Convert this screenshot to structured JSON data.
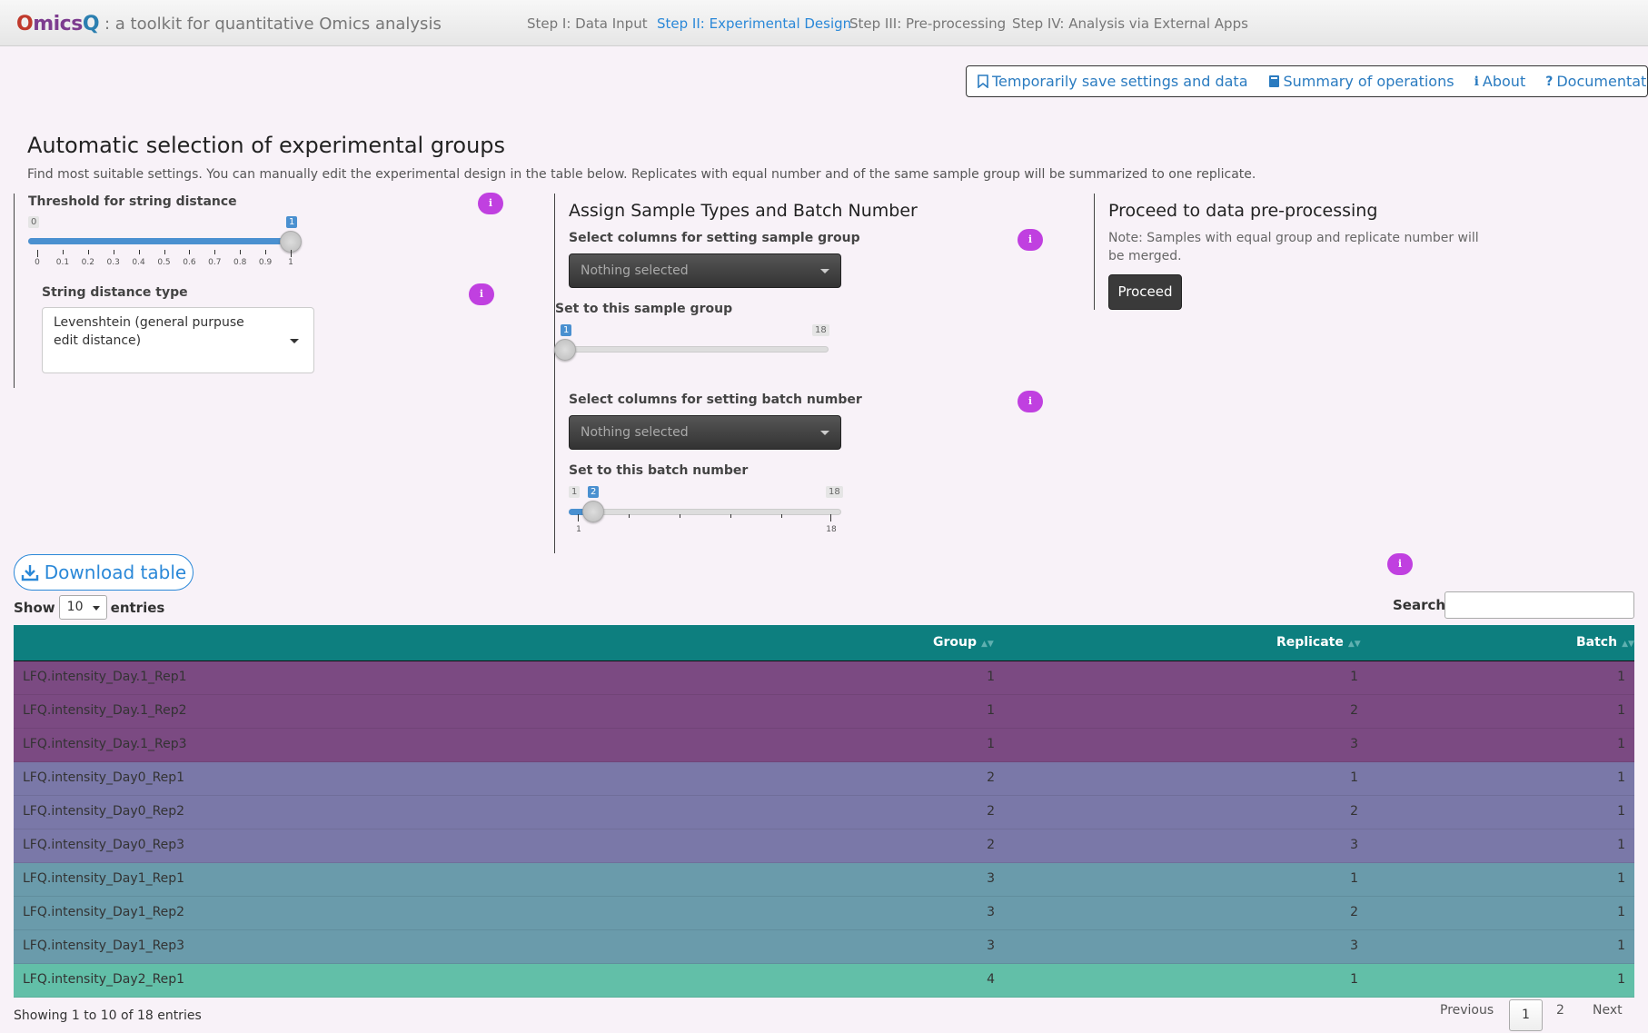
{
  "brand": {
    "logo": "OmicsQ",
    "subtitle": ": a toolkit for quantitative Omics analysis"
  },
  "nav": [
    {
      "label": "Step I: Data Input",
      "active": false
    },
    {
      "label": "Step II: Experimental Design",
      "active": true
    },
    {
      "label": "Step III: Pre-processing",
      "active": false
    },
    {
      "label": "Step IV: Analysis via External Apps",
      "active": false
    }
  ],
  "top_buttons": [
    {
      "label": "Temporarily save settings and data",
      "icon": "bookmark-icon"
    },
    {
      "label": "Summary of operations",
      "icon": "book-icon"
    },
    {
      "label": "About",
      "icon": "info-icon"
    },
    {
      "label": "Documentation",
      "icon": "question-icon"
    }
  ],
  "title": "Automatic selection of experimental groups",
  "description": "Find most suitable settings. You can manually edit the experimental design in the table below. Replicates with equal number and of the same sample group will be summarized to one replicate.",
  "threshold": {
    "label": "Threshold for string distance",
    "min": "0",
    "max": "1",
    "value": "1",
    "value_fraction": 1.0,
    "ticks": [
      "0",
      "0.1",
      "0.2",
      "0.3",
      "0.4",
      "0.5",
      "0.6",
      "0.7",
      "0.8",
      "0.9",
      "1"
    ]
  },
  "string_distance": {
    "label": "String distance type",
    "value": "Levenshtein (general purpuse edit distance)"
  },
  "assign": {
    "title": "Assign Sample Types and Batch Number",
    "group_select_label": "Select columns for setting sample group",
    "group_select_value": "Nothing selected",
    "group_slider_label": "Set to this sample group",
    "group_slider": {
      "min": "1",
      "max": "18",
      "value": "1",
      "value_fraction": 0.0
    },
    "batch_select_label": "Select columns for setting batch number",
    "batch_select_value": "Nothing selected",
    "batch_slider_label": "Set to this batch number",
    "batch_slider": {
      "min": "1",
      "max": "18",
      "value": "2",
      "value_fraction": 0.0588,
      "tick_min": "1",
      "tick_max": "18"
    }
  },
  "proceed": {
    "title": "Proceed to data pre-processing",
    "note": "Note: Samples with equal group and replicate number will be merged.",
    "button": "Proceed"
  },
  "download_label": "Download table",
  "show_label": "Show",
  "entries_value": "10",
  "entries_label": "entries",
  "search_label": "Search:",
  "table": {
    "headers": [
      "",
      "Group",
      "Replicate",
      "Batch"
    ],
    "rows": [
      {
        "name": "LFQ.intensity_Day.1_Rep1",
        "group": "1",
        "replicate": "1",
        "batch": "1",
        "color": "#7b4a82"
      },
      {
        "name": "LFQ.intensity_Day.1_Rep2",
        "group": "1",
        "replicate": "2",
        "batch": "1",
        "color": "#7b4a82"
      },
      {
        "name": "LFQ.intensity_Day.1_Rep3",
        "group": "1",
        "replicate": "3",
        "batch": "1",
        "color": "#7b4a82"
      },
      {
        "name": "LFQ.intensity_Day0_Rep1",
        "group": "2",
        "replicate": "1",
        "batch": "1",
        "color": "#7a78a8"
      },
      {
        "name": "LFQ.intensity_Day0_Rep2",
        "group": "2",
        "replicate": "2",
        "batch": "1",
        "color": "#7a78a8"
      },
      {
        "name": "LFQ.intensity_Day0_Rep3",
        "group": "2",
        "replicate": "3",
        "batch": "1",
        "color": "#7a78a8"
      },
      {
        "name": "LFQ.intensity_Day1_Rep1",
        "group": "3",
        "replicate": "1",
        "batch": "1",
        "color": "#6a9bab"
      },
      {
        "name": "LFQ.intensity_Day1_Rep2",
        "group": "3",
        "replicate": "2",
        "batch": "1",
        "color": "#6a9bab"
      },
      {
        "name": "LFQ.intensity_Day1_Rep3",
        "group": "3",
        "replicate": "3",
        "batch": "1",
        "color": "#6a9bab"
      },
      {
        "name": "LFQ.intensity_Day2_Rep1",
        "group": "4",
        "replicate": "1",
        "batch": "1",
        "color": "#62bfa8"
      }
    ]
  },
  "footer": {
    "info": "Showing 1 to 10 of 18 entries",
    "previous": "Previous",
    "pages": [
      "1",
      "2"
    ],
    "next": "Next"
  },
  "colors": {
    "accent": "#2a88d8",
    "header": "#0d7f7f",
    "info_bubble": "#c040e0"
  }
}
